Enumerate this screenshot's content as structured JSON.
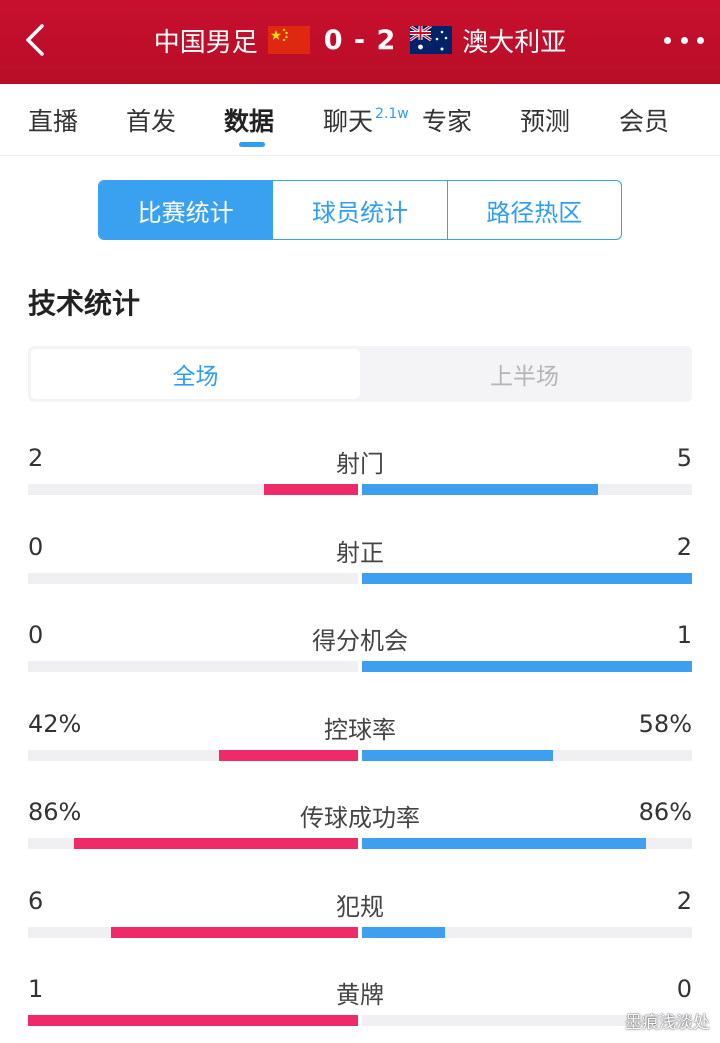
{
  "header": {
    "home_team": "中国男足",
    "score": "0 - 2",
    "away_team": "澳大利亚",
    "back_icon": "chevron-left-icon",
    "more_icon": "more-dots-icon",
    "home_flag": "china-flag-icon",
    "away_flag": "australia-flag-icon",
    "bg_color": "#c8102e"
  },
  "tabs": [
    {
      "label": "直播"
    },
    {
      "label": "首发"
    },
    {
      "label": "数据",
      "active": true
    },
    {
      "label": "聊天",
      "badge": "2.1w"
    },
    {
      "label": "专家"
    },
    {
      "label": "预测"
    },
    {
      "label": "会员"
    }
  ],
  "segments": [
    {
      "label": "比赛统计",
      "active": true
    },
    {
      "label": "球员统计"
    },
    {
      "label": "路径热区"
    }
  ],
  "section_title": "技术统计",
  "periods": [
    {
      "label": "全场",
      "active": true
    },
    {
      "label": "上半场"
    }
  ],
  "stats": [
    {
      "label": "射门",
      "home": "2",
      "away": "5",
      "home_share": 0.2857,
      "away_share": 0.7143
    },
    {
      "label": "射正",
      "home": "0",
      "away": "2",
      "home_share": 0.0,
      "away_share": 1.0
    },
    {
      "label": "得分机会",
      "home": "0",
      "away": "1",
      "home_share": 0.0,
      "away_share": 1.0
    },
    {
      "label": "控球率",
      "home": "42%",
      "away": "58%",
      "home_share": 0.42,
      "away_share": 0.58
    },
    {
      "label": "传球成功率",
      "home": "86%",
      "away": "86%",
      "home_share": 0.86,
      "away_share": 0.86
    },
    {
      "label": "犯规",
      "home": "6",
      "away": "2",
      "home_share": 0.75,
      "away_share": 0.25
    },
    {
      "label": "黄牌",
      "home": "1",
      "away": "0",
      "home_share": 1.0,
      "away_share": 0.0
    }
  ],
  "colors": {
    "home": "#ee2a68",
    "away": "#3e9ff0",
    "accent": "#2e9ef5"
  },
  "watermark": "墨痕浅淡处"
}
